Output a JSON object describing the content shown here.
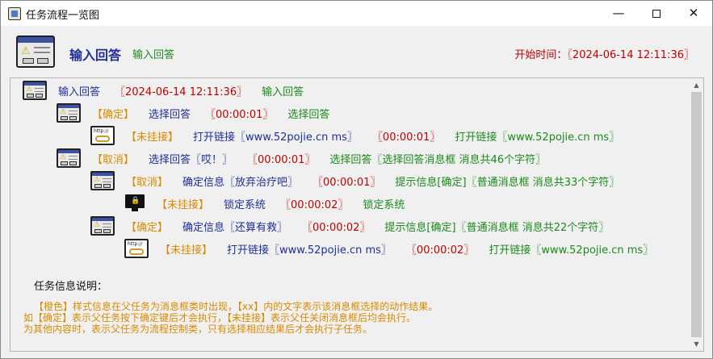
{
  "window": {
    "title": "任务流程一览图",
    "controls": {
      "minimize": "—",
      "close": "✕"
    }
  },
  "header": {
    "title": "输入回答",
    "subtitle": "输入回答",
    "start_time": "开始时间：〖2024-06-14 12:11:36〗"
  },
  "rows": [
    {
      "icon": "message-box-icon",
      "parts": [
        "输入回答",
        "〖2024-06-14 12:11:36〗",
        "输入回答"
      ]
    },
    {
      "icon": "message-box-icon",
      "parts": [
        "【确定】",
        "选择回答",
        "〖00:00:01〗",
        "选择回答"
      ]
    },
    {
      "icon": "link-icon",
      "parts": [
        "【未挂接】",
        "打开链接〖www.52pojie.cn ms〗",
        "〖00:00:01〗",
        "打开链接〖www.52pojie.cn ms〗"
      ]
    },
    {
      "icon": "message-box-icon",
      "parts": [
        "【取消】",
        "选择回答〖哎！〗",
        "〖00:00:01〗",
        "选择回答〖选择回答消息框 消息共46个字符〗"
      ]
    },
    {
      "icon": "message-box-icon",
      "parts": [
        "【取消】",
        "确定信息〖放弃治疗吧〗",
        "〖00:00:01〗",
        "提示信息[确定]〖普通消息框 消息共33个字符〗"
      ]
    },
    {
      "icon": "lock-screen-icon",
      "parts": [
        "【未挂接】",
        "锁定系统",
        "〖00:00:02〗",
        "锁定系统"
      ]
    },
    {
      "icon": "message-box-icon",
      "parts": [
        "【确定】",
        "确定信息〖还算有救〗",
        "〖00:00:02〗",
        "提示信息[确定]〖普通消息框 消息共22个字符〗"
      ]
    },
    {
      "icon": "link-icon",
      "parts": [
        "【未挂接】",
        "打开链接〖www.52pojie.cn ms〗",
        "〖00:00:02〗",
        "打开链接〖www.52pojie.cn ms〗"
      ]
    }
  ],
  "notes": {
    "heading": "任务信息说明：",
    "lines": [
      "【橙色】样式信息在父任务为消息框类时出现，【xx】内的文字表示该消息框选择的动作结果。",
      "如【确定】表示父任务按下确定键后才会执行，【未挂接】表示父任关闭消息框后均会执行。",
      "为其他内容时，表示父任务为流程控制类，只有选择相应结果后才会执行子任务。"
    ]
  },
  "colors": {
    "title_blue": "#1f2e9b",
    "time_red": "#c00000",
    "result_green": "#1a8a1a",
    "choice_orange": "#d98a00"
  }
}
